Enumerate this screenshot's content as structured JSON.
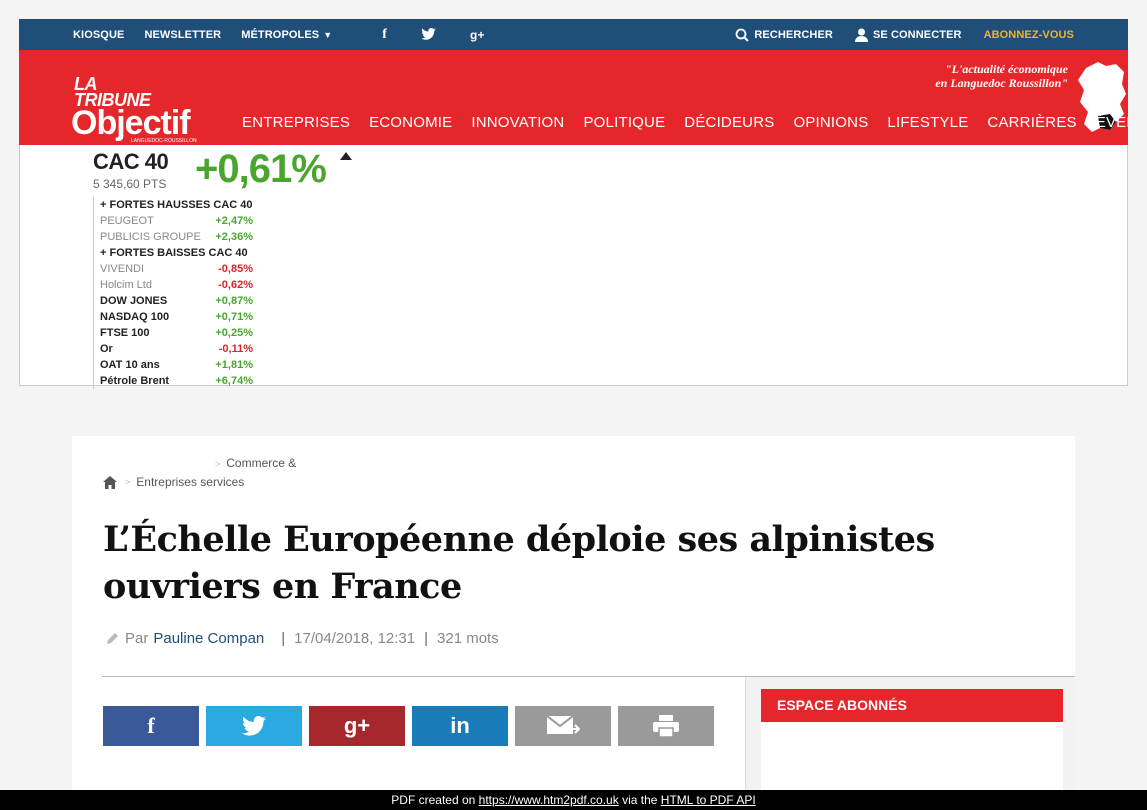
{
  "topbar": {
    "kiosque": "KIOSQUE",
    "newsletter": "NEWSLETTER",
    "metropoles": "MÉTROPOLES",
    "facebook": "f",
    "googleplus": "g+",
    "search": "RECHERCHER",
    "login": "SE CONNECTER",
    "subscribe": "ABONNEZ-VOUS"
  },
  "header": {
    "logo_la": "LA",
    "logo_tribune": "TRIBUNE",
    "logo_objectif": "Objectif",
    "logo_sub": "LANGUEDOC-ROUSSILLON",
    "tagline_1": "\"L'actualité économique",
    "tagline_2": "en Languedoc Roussillon\"",
    "nav": [
      "ENTREPRISES",
      "ECONOMIE",
      "INNOVATION",
      "POLITIQUE",
      "DÉCIDEURS",
      "OPINIONS",
      "LIFESTYLE",
      "CARRIÈRES",
      "ÉVÉNEMENTS"
    ]
  },
  "market": {
    "index": "CAC 40",
    "points": "5 345,60 PTS",
    "change": "+0,61%",
    "hausses_title": "+ FORTES HAUSSES CAC 40",
    "hausses": [
      {
        "name": "PEUGEOT",
        "value": "+2,47%"
      },
      {
        "name": "PUBLICIS GROUPE",
        "value": "+2,36%"
      }
    ],
    "baisses_title": "+ FORTES BAISSES CAC 40",
    "baisses": [
      {
        "name": "VIVENDI",
        "value": "-0,85%"
      },
      {
        "name": "Holcim Ltd",
        "value": "-0,62%"
      }
    ],
    "others": [
      {
        "name": "DOW JONES",
        "value": "+0,87%",
        "dir": "up"
      },
      {
        "name": "NASDAQ 100",
        "value": "+0,71%",
        "dir": "up"
      },
      {
        "name": "FTSE 100",
        "value": "+0,25%",
        "dir": "up"
      },
      {
        "name": "Or",
        "value": "-0,11%",
        "dir": "down"
      },
      {
        "name": "OAT 10 ans",
        "value": "+1,81%",
        "dir": "up"
      },
      {
        "name": "Pétrole Brent",
        "value": "+6,74%",
        "dir": "up"
      }
    ],
    "colors": {
      "up": "#4aa52f",
      "down": "#d8262a"
    }
  },
  "article": {
    "breadcrumb_1": "Commerce &",
    "breadcrumb_2": "Entreprises services",
    "breadcrumb_sep": ">",
    "title": "L’Échelle Européenne déploie ses alpinistes ouvriers en France",
    "by": "Par",
    "author": "Pauline Compan",
    "date": "17/04/2018, 12:31",
    "words": "321  mots",
    "meta_sep": "|",
    "share_labels": [
      "f",
      "t",
      "g+",
      "in",
      "mail",
      "print"
    ],
    "share_colors": [
      "#3b5998",
      "#2ba9e1",
      "#a6272c",
      "#1a7bb9",
      "#9a9a9a",
      "#9a9a9a"
    ],
    "espace_abonnes": "ESPACE ABONNÉS"
  },
  "footer": {
    "prefix": "PDF created on",
    "url": "https://www.htm2pdf.co.uk",
    "middle": "via the",
    "api": "HTML to PDF API"
  },
  "colors": {
    "brand_red": "#e5262a",
    "brand_blue": "#1f4e79",
    "accent_gold": "#f0b232"
  }
}
